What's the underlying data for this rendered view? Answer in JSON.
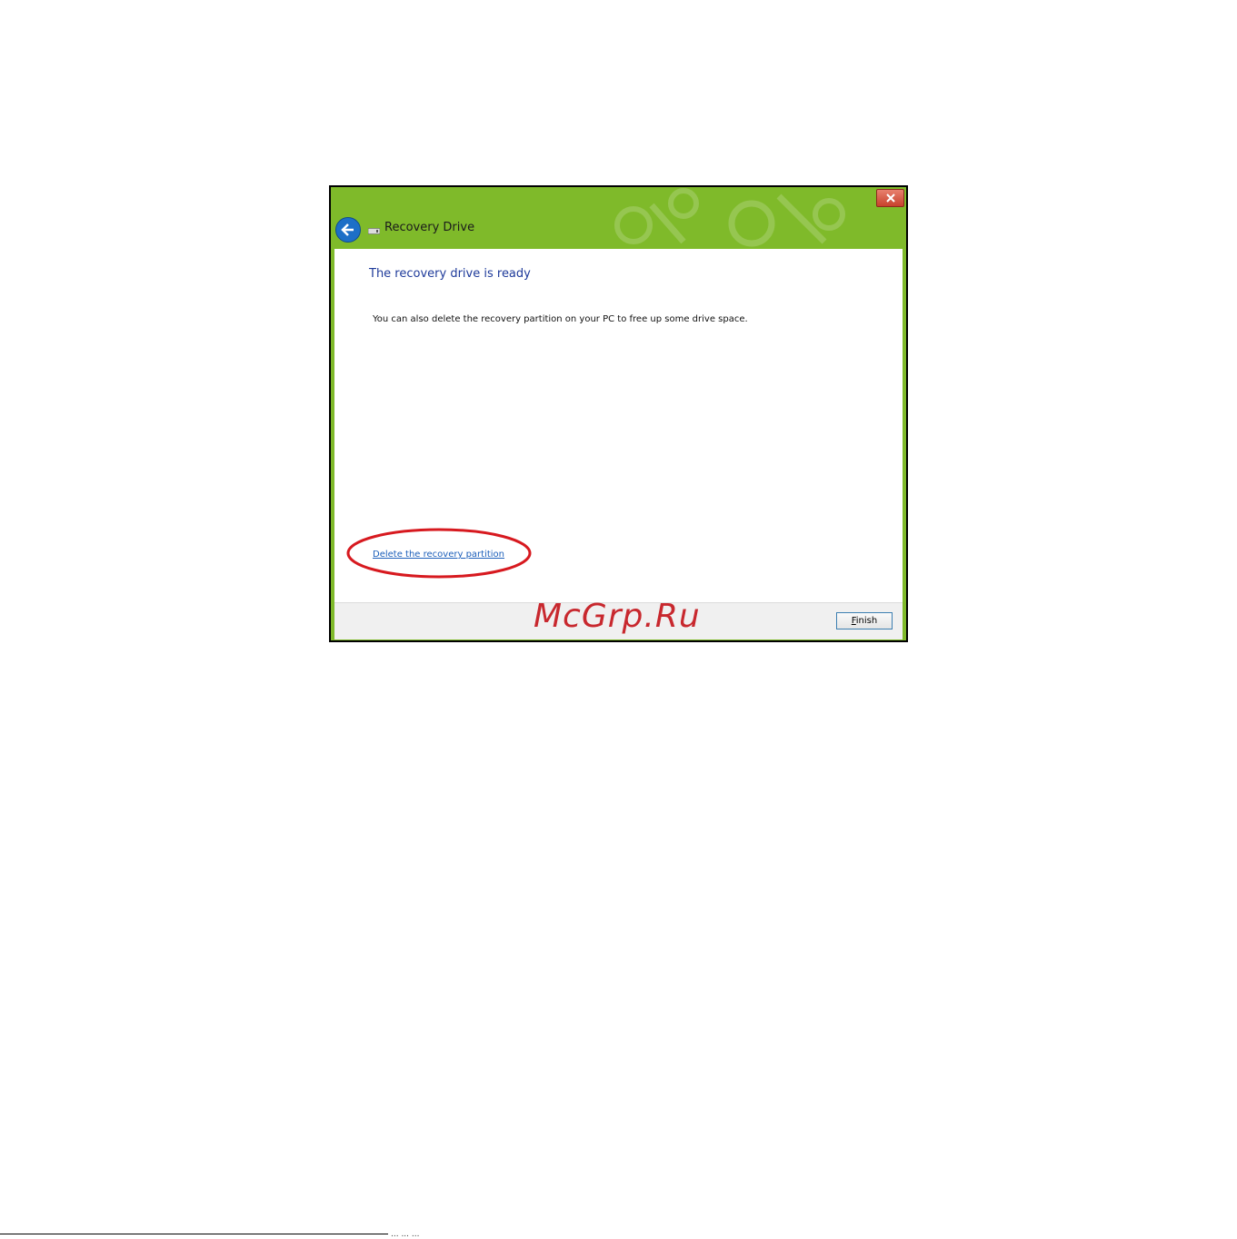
{
  "window": {
    "title": "Recovery Drive",
    "header_color": "#7fba2a"
  },
  "content": {
    "heading": "The recovery drive is ready",
    "description": "You can also delete the recovery partition on your PC to free up some drive space.",
    "delete_link": "Delete the recovery partition",
    "highlight_color": "#d7191f"
  },
  "footer": {
    "finish_accel": "F",
    "finish_rest": "inish"
  },
  "watermark": "McGrp.Ru",
  "page_footer_text": "... ... ...",
  "icons": {
    "close": "close-icon",
    "back": "back-arrow-icon",
    "drive": "usb-drive-icon"
  }
}
